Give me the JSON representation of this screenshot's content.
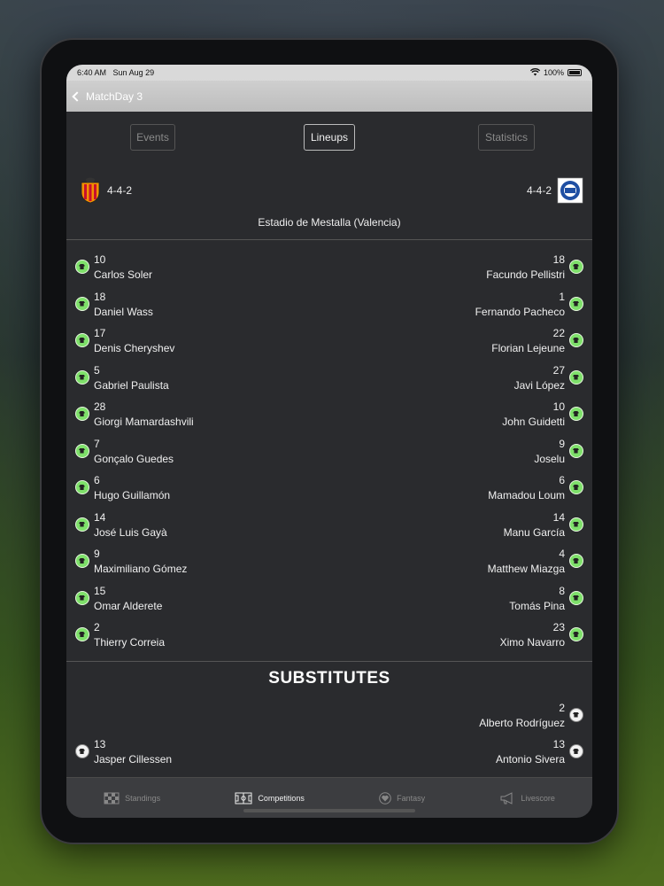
{
  "statusbar": {
    "time": "6:40 AM",
    "date": "Sun Aug 29",
    "battery": "100%"
  },
  "navbar": {
    "back_label": "MatchDay 3"
  },
  "tabs": [
    {
      "label": "Events",
      "active": false
    },
    {
      "label": "Lineups",
      "active": true
    },
    {
      "label": "Statistics",
      "active": false
    }
  ],
  "home": {
    "formation": "4-4-2",
    "crest_color": "#f29100"
  },
  "away": {
    "formation": "4-4-2",
    "crest_color": "#1f4fa3"
  },
  "stadium": "Estadio de Mestalla (Valencia)",
  "lineup": [
    {
      "home_num": "10",
      "home_name": "Carlos Soler",
      "away_num": "18",
      "away_name": "Facundo Pellistri"
    },
    {
      "home_num": "18",
      "home_name": "Daniel Wass",
      "away_num": "1",
      "away_name": "Fernando Pacheco"
    },
    {
      "home_num": "17",
      "home_name": "Denis Cheryshev",
      "away_num": "22",
      "away_name": "Florian Lejeune"
    },
    {
      "home_num": "5",
      "home_name": "Gabriel Paulista",
      "away_num": "27",
      "away_name": "Javi López"
    },
    {
      "home_num": "28",
      "home_name": "Giorgi Mamardashvili",
      "away_num": "10",
      "away_name": "John Guidetti"
    },
    {
      "home_num": "7",
      "home_name": "Gonçalo Guedes",
      "away_num": "9",
      "away_name": "Joselu"
    },
    {
      "home_num": "6",
      "home_name": "Hugo Guillamón",
      "away_num": "6",
      "away_name": "Mamadou Loum"
    },
    {
      "home_num": "14",
      "home_name": "José Luis Gayà",
      "away_num": "14",
      "away_name": "Manu García"
    },
    {
      "home_num": "9",
      "home_name": "Maximiliano Gómez",
      "away_num": "4",
      "away_name": "Matthew Miazga"
    },
    {
      "home_num": "15",
      "home_name": "Omar Alderete",
      "away_num": "8",
      "away_name": "Tomás Pina"
    },
    {
      "home_num": "2",
      "home_name": "Thierry Correia",
      "away_num": "23",
      "away_name": "Ximo Navarro"
    }
  ],
  "substitutes_title": "SUBSTITUTES",
  "substitutes": [
    {
      "home_num": "",
      "home_name": "",
      "away_num": "2",
      "away_name": "Alberto Rodríguez"
    },
    {
      "home_num": "13",
      "home_name": "Jasper Cillessen",
      "away_num": "13",
      "away_name": "Antonio Sivera"
    }
  ],
  "tabbar": [
    {
      "label": "Standings",
      "icon": "checkered-flag-icon",
      "active": false
    },
    {
      "label": "Competitions",
      "icon": "pitch-icon",
      "active": true
    },
    {
      "label": "Fantasy",
      "icon": "heart-icon",
      "active": false
    },
    {
      "label": "Livescore",
      "icon": "megaphone-icon",
      "active": false
    }
  ]
}
